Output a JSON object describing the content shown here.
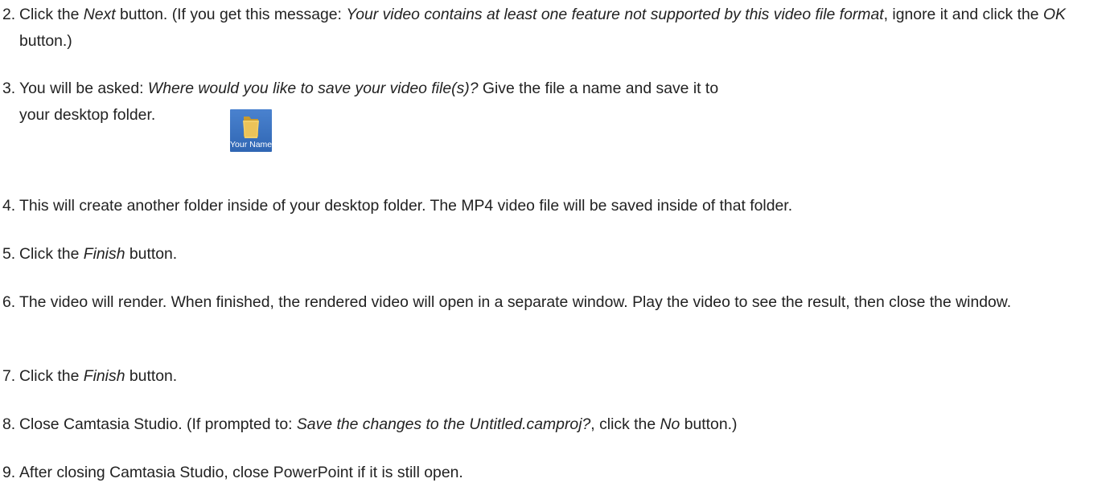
{
  "steps": [
    {
      "num": "2.",
      "segments": [
        {
          "t": "Click the "
        },
        {
          "t": "Next",
          "i": true
        },
        {
          "t": " button. (If you get this message: "
        },
        {
          "t": "Your video contains at least one feature not supported by this video file format",
          "i": true
        },
        {
          "t": ", ignore it and click the "
        },
        {
          "t": "OK",
          "i": true
        },
        {
          "t": " button.)"
        }
      ]
    },
    {
      "num": "3.",
      "segments": [
        {
          "t": "You will be asked: "
        },
        {
          "t": "Where would you like to save your video file(s)?",
          "i": true
        },
        {
          "t": " Give the file a name and save it to"
        }
      ],
      "line2": "your desktop folder."
    },
    {
      "num": "4.",
      "segments": [
        {
          "t": "This will create another folder inside of your desktop folder. The MP4 video file will be saved inside of that folder."
        }
      ]
    },
    {
      "num": "5.",
      "segments": [
        {
          "t": "Click the "
        },
        {
          "t": "Finish",
          "i": true
        },
        {
          "t": " button."
        }
      ]
    },
    {
      "num": "6.",
      "segments": [
        {
          "t": "The video will render. When finished, the rendered video will open in a separate window. Play the video to see the result, then close the window."
        }
      ]
    },
    {
      "num": "7.",
      "segments": [
        {
          "t": "Click the "
        },
        {
          "t": "Finish",
          "i": true
        },
        {
          "t": " button."
        }
      ]
    },
    {
      "num": "8.",
      "segments": [
        {
          "t": "Close Camtasia Studio. (If prompted to: "
        },
        {
          "t": "Save the changes to the Untitled.camproj?",
          "i": true
        },
        {
          "t": ", click the "
        },
        {
          "t": "No",
          "i": true
        },
        {
          "t": " button.)"
        }
      ]
    },
    {
      "num": "9.",
      "segments": [
        {
          "t": "After closing Camtasia Studio, close PowerPoint if it is still open."
        }
      ]
    }
  ],
  "folder_icon": {
    "label": "Your Name",
    "icon": "folder-icon",
    "tile_color": "#3b74c2",
    "folder_color": "#e8c25a"
  }
}
